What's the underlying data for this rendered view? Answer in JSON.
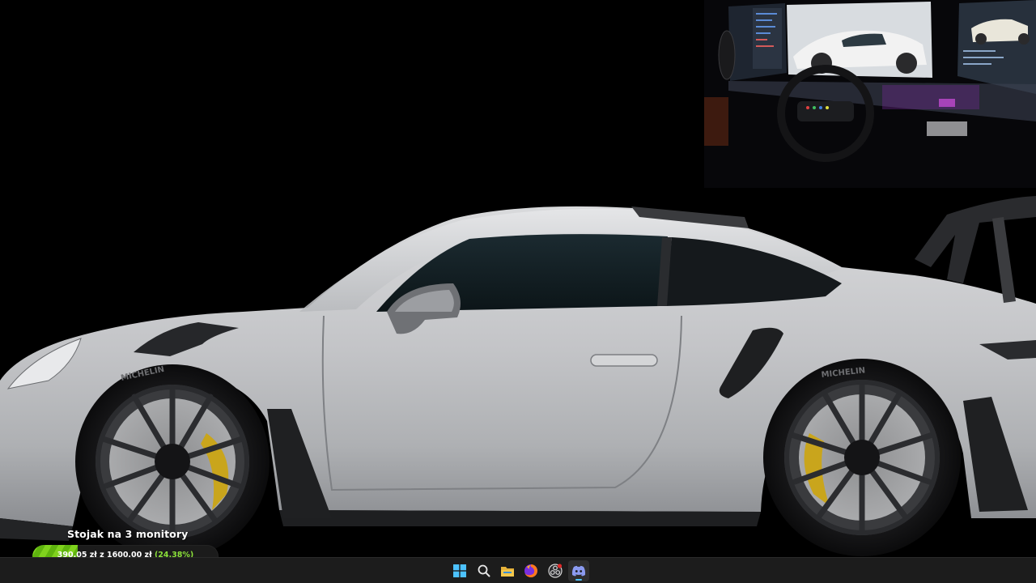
{
  "scene": {
    "description_icon": "car-scene",
    "tire_brand": "MICHELIN"
  },
  "goal": {
    "title": "Stojak na 3 monitory",
    "current": "390,05 zł",
    "separator": "z",
    "target": "1600,00 zł",
    "percent_label": "(24.38%)",
    "progress_fraction": 0.2438,
    "fill_color": "#7fd21d"
  },
  "taskbar": {
    "icons": [
      {
        "name": "windows-start-icon",
        "active": false
      },
      {
        "name": "search-icon",
        "active": false
      },
      {
        "name": "file-explorer-icon",
        "active": false
      },
      {
        "name": "firefox-icon",
        "active": false
      },
      {
        "name": "obs-icon",
        "active": false
      },
      {
        "name": "discord-icon",
        "active": true
      }
    ]
  }
}
